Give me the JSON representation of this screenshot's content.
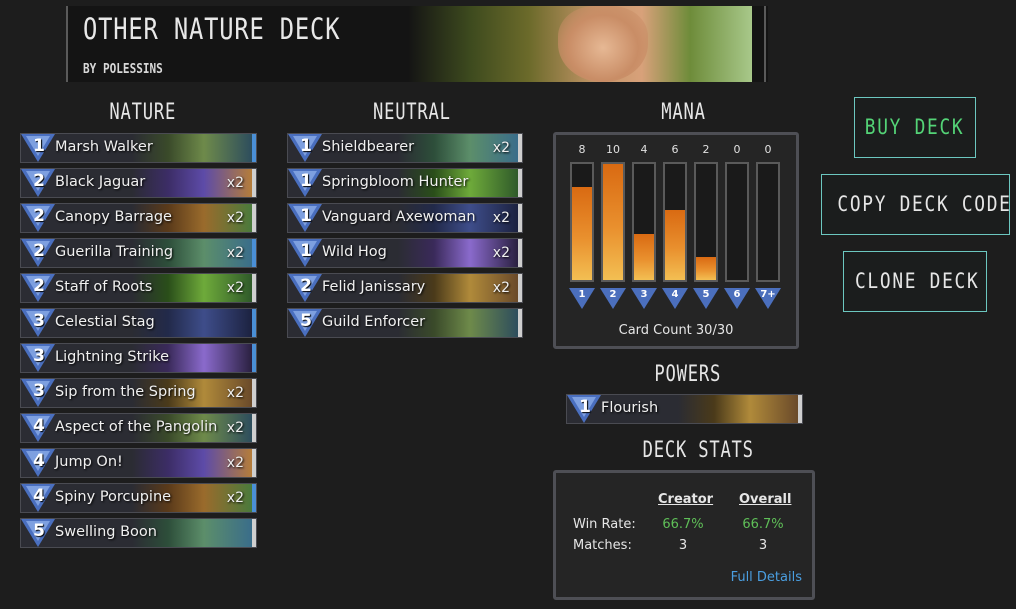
{
  "deck": {
    "title": "OTHER NATURE DECK",
    "author": "BY POLESSINS"
  },
  "sections": {
    "nature": "NATURE",
    "neutral": "NEUTRAL",
    "mana": "MANA",
    "powers": "POWERS",
    "deck_stats": "DECK STATS"
  },
  "nature_cards": [
    {
      "cost": "1",
      "name": "Marsh Walker",
      "qty": "",
      "legendary": true
    },
    {
      "cost": "2",
      "name": "Black Jaguar",
      "qty": "x2",
      "legendary": false
    },
    {
      "cost": "2",
      "name": "Canopy Barrage",
      "qty": "x2",
      "legendary": false
    },
    {
      "cost": "2",
      "name": "Guerilla Training",
      "qty": "x2",
      "legendary": true
    },
    {
      "cost": "2",
      "name": "Staff of Roots",
      "qty": "x2",
      "legendary": false
    },
    {
      "cost": "3",
      "name": "Celestial Stag",
      "qty": "",
      "legendary": true
    },
    {
      "cost": "3",
      "name": "Lightning Strike",
      "qty": "",
      "legendary": true
    },
    {
      "cost": "3",
      "name": "Sip from the Spring",
      "qty": "x2",
      "legendary": false
    },
    {
      "cost": "4",
      "name": "Aspect of the Pangolin",
      "qty": "x2",
      "legendary": false
    },
    {
      "cost": "4",
      "name": "Jump On!",
      "qty": "x2",
      "legendary": false
    },
    {
      "cost": "4",
      "name": "Spiny Porcupine",
      "qty": "x2",
      "legendary": true
    },
    {
      "cost": "5",
      "name": "Swelling Boon",
      "qty": "",
      "legendary": false
    }
  ],
  "neutral_cards": [
    {
      "cost": "1",
      "name": "Shieldbearer",
      "qty": "x2",
      "legendary": false
    },
    {
      "cost": "1",
      "name": "Springbloom Hunter",
      "qty": "",
      "legendary": false
    },
    {
      "cost": "1",
      "name": "Vanguard Axewoman",
      "qty": "x2",
      "legendary": false
    },
    {
      "cost": "1",
      "name": "Wild Hog",
      "qty": "x2",
      "legendary": false
    },
    {
      "cost": "2",
      "name": "Felid Janissary",
      "qty": "x2",
      "legendary": false
    },
    {
      "cost": "5",
      "name": "Guild Enforcer",
      "qty": "",
      "legendary": false
    }
  ],
  "mana": {
    "costs": [
      "1",
      "2",
      "3",
      "4",
      "5",
      "6",
      "7+"
    ],
    "counts": [
      "8",
      "10",
      "4",
      "6",
      "2",
      "0",
      "0"
    ],
    "fill_fraction": [
      0.8,
      1.0,
      0.4,
      0.6,
      0.2,
      0,
      0
    ],
    "card_count": "Card Count 30/30"
  },
  "powers": [
    {
      "cost": "1",
      "name": "Flourish"
    }
  ],
  "stats": {
    "creator_header": "Creator",
    "overall_header": "Overall",
    "win_rate_label": "Win Rate:",
    "matches_label": "Matches:",
    "creator_win_rate": "66.7%",
    "overall_win_rate": "66.7%",
    "creator_matches": "3",
    "overall_matches": "3",
    "details_link": "Full Details"
  },
  "buttons": {
    "buy": "BUY DECK",
    "copy": "COPY DECK CODE",
    "clone": "CLONE DECK"
  },
  "colors": {
    "accent_teal": "#6cc7c0",
    "buy_green": "#54d477",
    "win_green": "#5fbf58",
    "cost_blue": "#4a6fbf",
    "legendary_edge": "#4a8fd6",
    "mana_orange": "#e9902e"
  }
}
